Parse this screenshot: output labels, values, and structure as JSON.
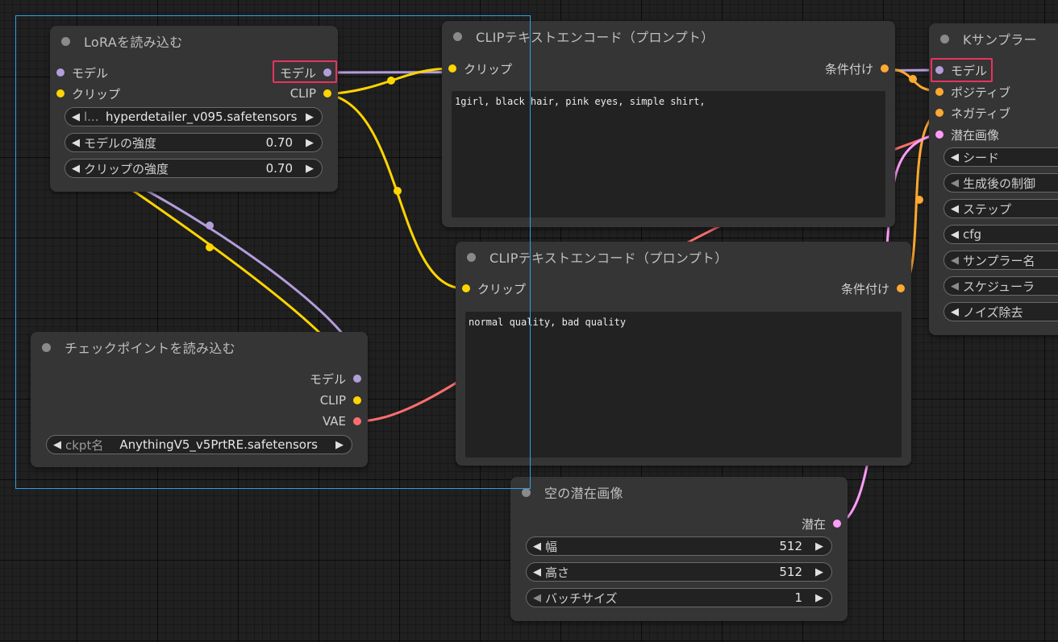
{
  "colors": {
    "model": "#b39ddb",
    "clip": "#ffd500",
    "cond": "#ffa931",
    "latent": "#ff9cf9",
    "vae": "#ff6e6e",
    "highlight": "#e8335f",
    "selection": "#2ea0e6"
  },
  "lora": {
    "title": "LoRAを読み込む",
    "inputs": {
      "model": "モデル",
      "clip": "クリップ"
    },
    "outputs": {
      "model": "モデル",
      "clip": "CLIP"
    },
    "widgets": {
      "lora_name": {
        "label": "l...",
        "value": "hyperdetailer_v095.safetensors"
      },
      "model_strength": {
        "label": "モデルの強度",
        "value": "0.70"
      },
      "clip_strength": {
        "label": "クリップの強度",
        "value": "0.70"
      }
    }
  },
  "clip_pos": {
    "title": "CLIPテキストエンコード（プロンプト）",
    "input": "クリップ",
    "output": "条件付け",
    "text": "1girl, black hair, pink eyes, simple shirt,"
  },
  "clip_neg": {
    "title": "CLIPテキストエンコード（プロンプト）",
    "input": "クリップ",
    "output": "条件付け",
    "text": "normal quality, bad quality"
  },
  "ksampler": {
    "title": "Kサンプラー",
    "inputs": {
      "model": "モデル",
      "positive": "ポジティブ",
      "negative": "ネガティブ",
      "latent": "潜在画像"
    },
    "widgets": {
      "seed": "シード",
      "control": "生成後の制御",
      "steps": "ステップ",
      "cfg": "cfg",
      "sampler": "サンプラー名",
      "scheduler": "スケジューラ",
      "denoise": "ノイズ除去"
    }
  },
  "checkpoint": {
    "title": "チェックポイントを読み込む",
    "outputs": {
      "model": "モデル",
      "clip": "CLIP",
      "vae": "VAE"
    },
    "widget": {
      "label": "ckpt名",
      "value": "AnythingV5_v5PrtRE.safetensors"
    }
  },
  "latent": {
    "title": "空の潜在画像",
    "output": "潜在",
    "widgets": {
      "width": {
        "label": "幅",
        "value": "512"
      },
      "height": {
        "label": "高さ",
        "value": "512"
      },
      "batch": {
        "label": "バッチサイズ",
        "value": "1"
      }
    }
  }
}
